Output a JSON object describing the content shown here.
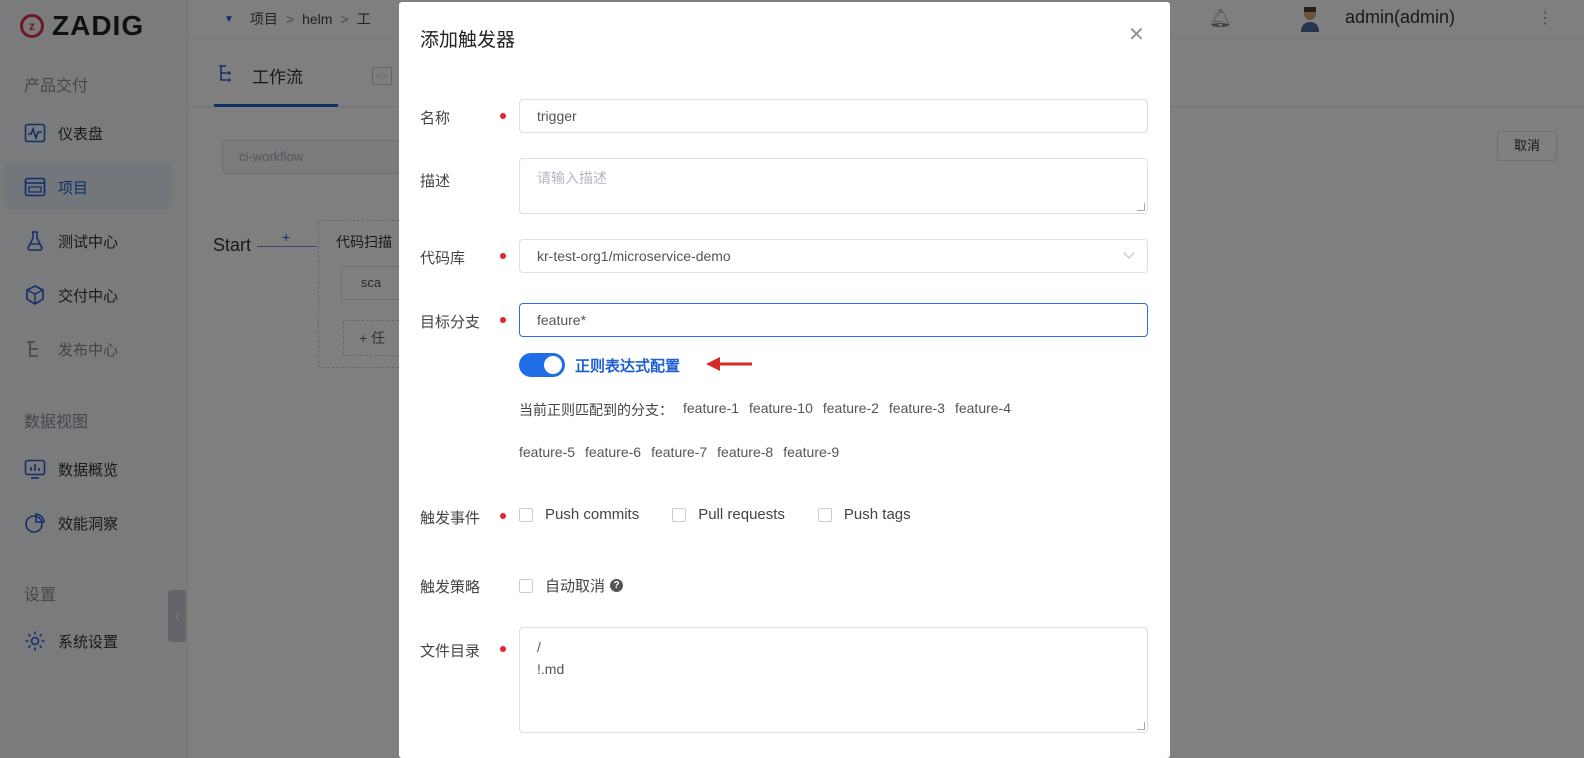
{
  "brand": {
    "logo_text": "ZADIG"
  },
  "sidebar": {
    "section_product": "产品交付",
    "section_data": "数据视图",
    "section_settings": "设置",
    "items": [
      {
        "label": "仪表盘",
        "icon": "dashboard-icon"
      },
      {
        "label": "项目",
        "icon": "project-icon"
      },
      {
        "label": "测试中心",
        "icon": "flask-icon"
      },
      {
        "label": "交付中心",
        "icon": "package-icon"
      },
      {
        "label": "发布中心",
        "icon": "release-icon"
      },
      {
        "label": "数据概览",
        "icon": "monitor-chart-icon"
      },
      {
        "label": "效能洞察",
        "icon": "pie-chart-icon"
      },
      {
        "label": "系统设置",
        "icon": "gear-icon"
      }
    ]
  },
  "topbar": {
    "breadcrumb": [
      "项目",
      "helm",
      "工"
    ],
    "user": "admin(admin)"
  },
  "tabs": {
    "workflow": "工作流"
  },
  "workspace": {
    "workflow_name": "ci-workflow",
    "cancel": "取消",
    "start": "Start",
    "stage_title": "代码扫描",
    "job_label": "sca",
    "add_job": "+ 任"
  },
  "dialog": {
    "title": "添加触发器",
    "name_label": "名称",
    "name_value": "trigger",
    "desc_label": "描述",
    "desc_placeholder": "请输入描述",
    "repo_label": "代码库",
    "repo_value": "kr-test-org1/microservice-demo",
    "branch_label": "目标分支",
    "branch_value": "feature*",
    "regex_label": "正则表达式配置",
    "regex_enabled": true,
    "match_prefix": "当前正则匹配到的分支：",
    "matched_branches_line1": [
      "feature-1",
      "feature-10",
      "feature-2",
      "feature-3",
      "feature-4"
    ],
    "matched_branches_line2": [
      "feature-5",
      "feature-6",
      "feature-7",
      "feature-8",
      "feature-9"
    ],
    "event_label": "触发事件",
    "events": [
      "Push commits",
      "Pull requests",
      "Push tags"
    ],
    "strategy_label": "触发策略",
    "strategy_option": "自动取消",
    "dir_label": "文件目录",
    "dir_lines": [
      "/",
      "!.md"
    ]
  }
}
